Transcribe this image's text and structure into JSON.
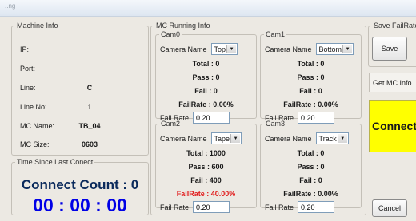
{
  "window": {
    "title": "..ng"
  },
  "machine_info": {
    "title": "Machine Info",
    "rows": [
      {
        "label": "IP:",
        "value": ""
      },
      {
        "label": "Port:",
        "value": ""
      },
      {
        "label": "Line:",
        "value": "C"
      },
      {
        "label": "Line No:",
        "value": "1"
      },
      {
        "label": "MC Name:",
        "value": "TB_04"
      },
      {
        "label": "MC Size:",
        "value": "0603"
      }
    ]
  },
  "timer": {
    "title": "Time Since Last Conect",
    "connect_count": "Connect Count : 0",
    "time": "00 : 00 : 00"
  },
  "mc_running": {
    "title": "MC Running Info",
    "camera_name_label": "Camera Name",
    "fail_rate_label": "Fail Rate",
    "cams": [
      {
        "title": "Cam0",
        "camera": "Top",
        "total": "Total : 0",
        "pass": "Pass : 0",
        "fail": "Fail : 0",
        "failrate": "FailRate : 0.00%",
        "rate": "0.20"
      },
      {
        "title": "Cam1",
        "camera": "Bottom",
        "total": "Total : 0",
        "pass": "Pass : 0",
        "fail": "Fail : 0",
        "failrate": "FailRate : 0.00%",
        "rate": "0.20"
      },
      {
        "title": "Cam2",
        "camera": "Tape",
        "total": "Total : 1000",
        "pass": "Pass : 600",
        "fail": "Fail : 400",
        "failrate": "FailRate : 40.00%",
        "rate": "0.20"
      },
      {
        "title": "Cam3",
        "camera": "Track",
        "total": "Total : 0",
        "pass": "Pass : 0",
        "fail": "Fail : 0",
        "failrate": "FailRate : 0.00%",
        "rate": "0.20"
      }
    ]
  },
  "right_panel": {
    "save_title": "Save FailRate",
    "save_button": "Save",
    "get_mc_info": "Get MC Info",
    "connect_button": "Connect",
    "cancel_button": "Cancel"
  },
  "colors": {
    "connect_bg": "#ffff00",
    "timer_text": "#0000e6",
    "alert_text": "#e11c1c"
  }
}
